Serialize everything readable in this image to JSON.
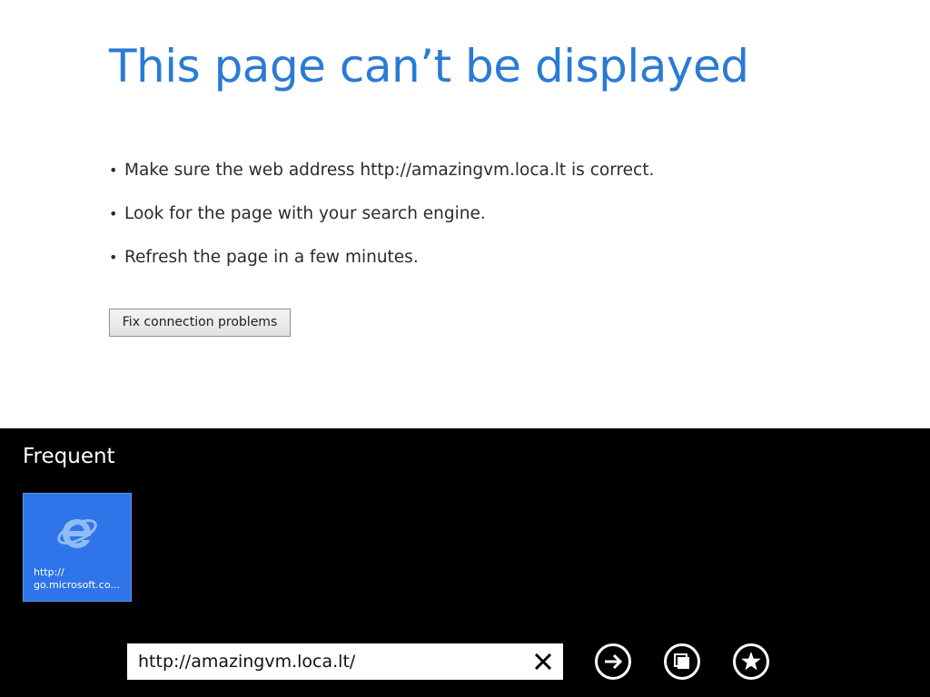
{
  "error": {
    "title": "This page can’t be displayed",
    "suggestions": [
      "Make sure the web address http://amazingvm.loca.lt is correct.",
      "Look for the page with your search engine.",
      "Refresh the page in a few minutes."
    ],
    "fix_button_label": "Fix connection problems"
  },
  "appbar": {
    "frequent_heading": "Frequent",
    "tiles": [
      {
        "icon": "internet-explorer-icon",
        "label_line1": "http://",
        "label_line2": "go.microsoft.co..."
      }
    ],
    "address": {
      "value": "http://amazingvm.loca.lt/"
    },
    "buttons": {
      "clear_icon": "close-icon",
      "go_icon": "arrow-right-icon",
      "tabs_icon": "tabs-icon",
      "favorites_icon": "star-icon"
    }
  },
  "colors": {
    "title_blue": "#2a7bd4",
    "tile_blue": "#2f74e8",
    "appbar_bg": "#000000"
  }
}
